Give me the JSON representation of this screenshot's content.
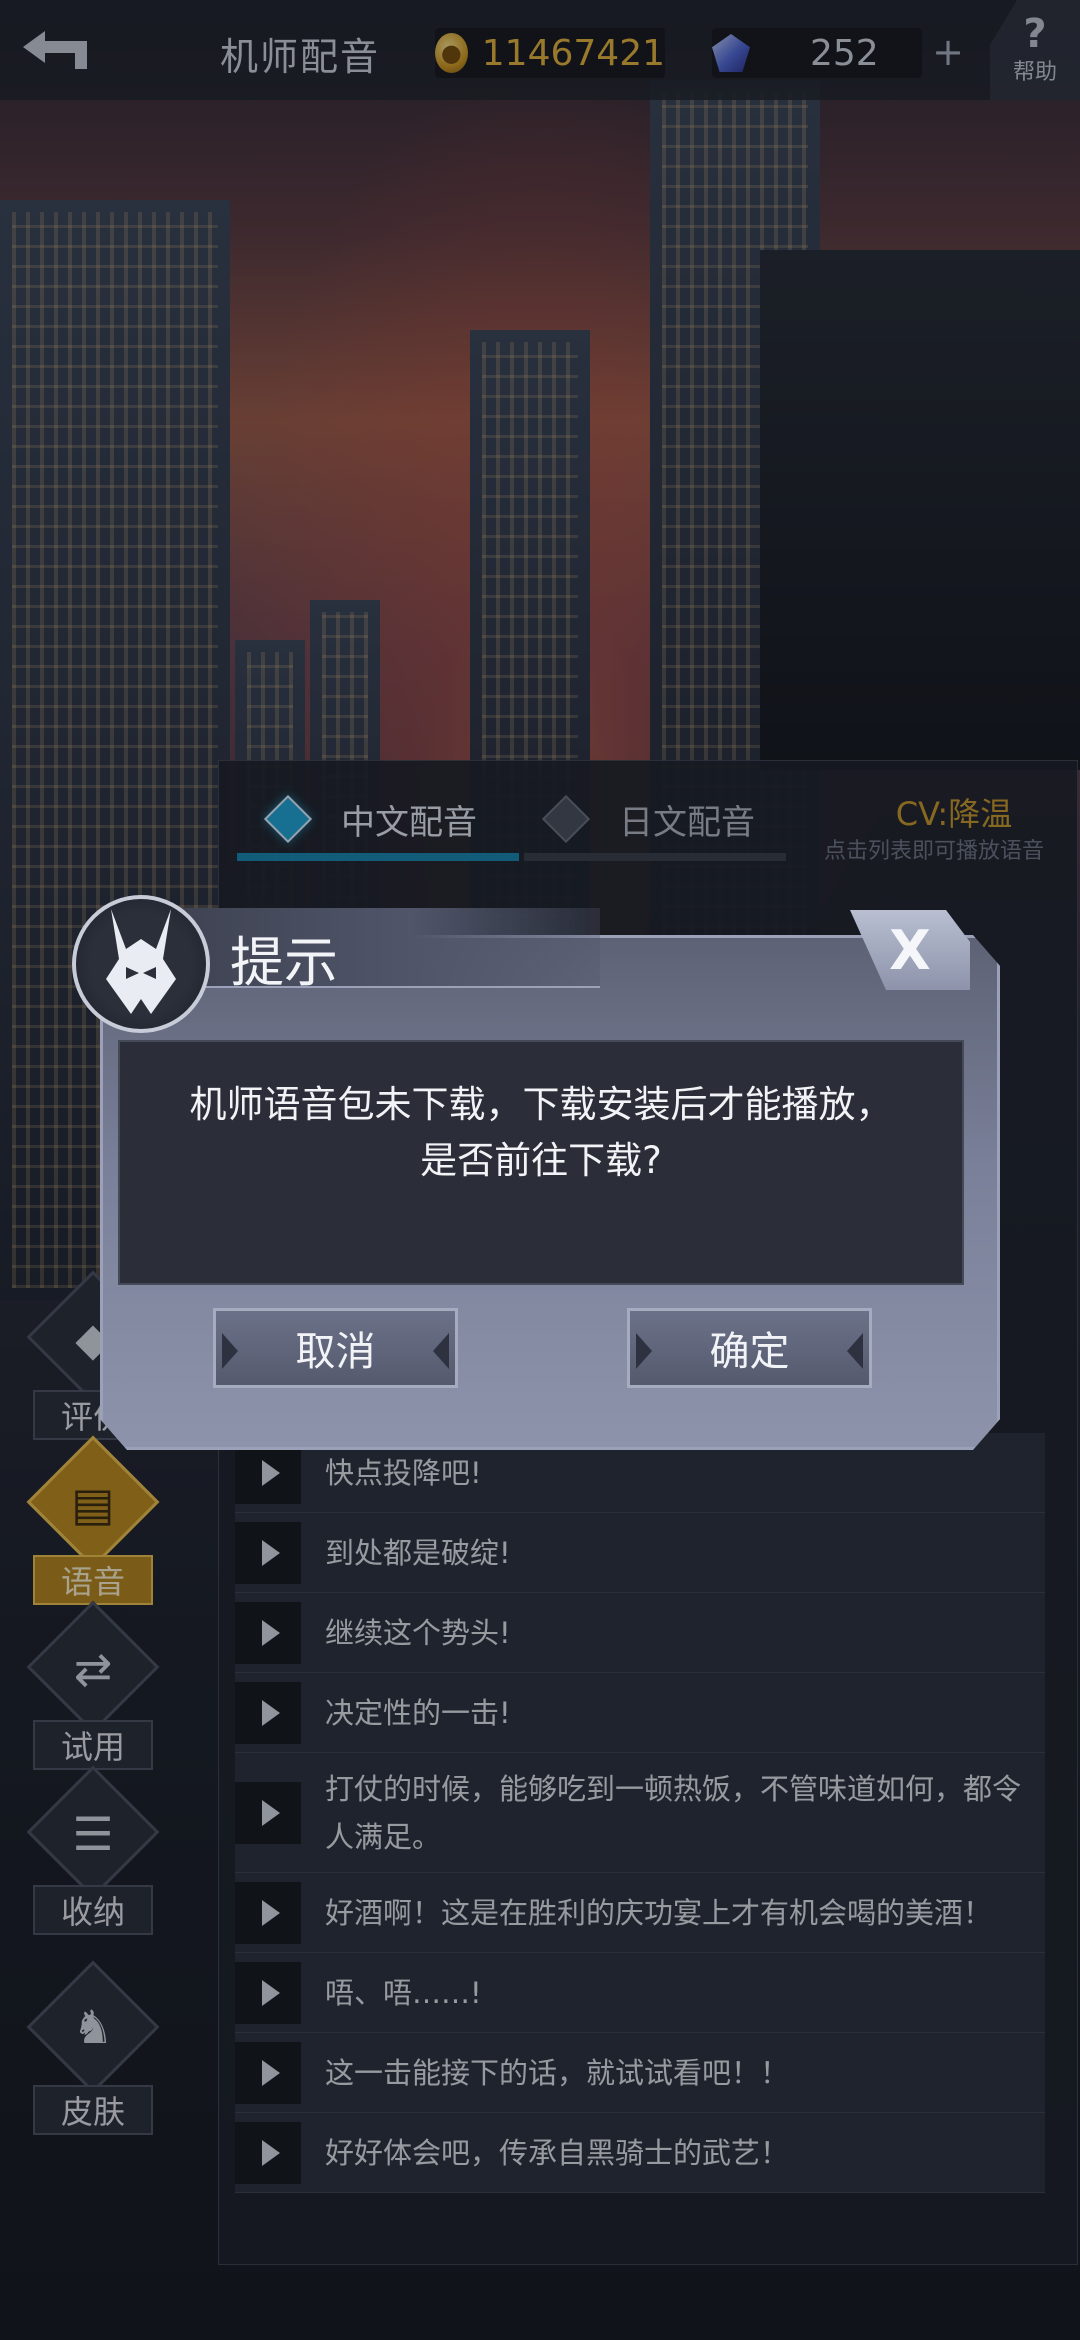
{
  "header": {
    "title": "机师配音",
    "gold_amount": "11467421",
    "gem_amount": "252",
    "plus_label": "+",
    "help_label": "帮助"
  },
  "voice_panel": {
    "tabs": [
      {
        "label": "中文配音",
        "active": true
      },
      {
        "label": "日文配音",
        "active": false
      }
    ],
    "cv_label": "CV:降温",
    "hint": "点击列表即可播放语音",
    "items": [
      {
        "text": "快点投降吧!"
      },
      {
        "text": "到处都是破绽!"
      },
      {
        "text": "继续这个势头!"
      },
      {
        "text": "决定性的一击!"
      },
      {
        "text": "打仗的时候，能够吃到一顿热饭，不管味道如何，都令人满足。"
      },
      {
        "text": "好酒啊！这是在胜利的庆功宴上才有机会喝的美酒！"
      },
      {
        "text": "唔、唔……!"
      },
      {
        "text": "这一击能接下的话，就试试看吧！！"
      },
      {
        "text": "好好体会吧，传承自黑骑士的武艺！"
      }
    ]
  },
  "side_menu": [
    {
      "label": "评价",
      "icon": "rating-icon",
      "active": false
    },
    {
      "label": "语音",
      "icon": "voice-icon",
      "active": true
    },
    {
      "label": "试用",
      "icon": "trial-icon",
      "active": false
    },
    {
      "label": "收纳",
      "icon": "storage-icon",
      "active": false
    },
    {
      "label": "皮肤",
      "icon": "skin-icon",
      "active": false
    }
  ],
  "dialog": {
    "title": "提示",
    "close_label": "X",
    "message_line1": "机师语音包未下载，下载安装后才能播放，",
    "message_line2": "是否前往下载?",
    "cancel_label": "取消",
    "confirm_label": "确定"
  },
  "colors": {
    "accent_gold": "#c99a2a",
    "tab_active": "#1fa5d8",
    "dialog_frame": "#8d93aa"
  }
}
